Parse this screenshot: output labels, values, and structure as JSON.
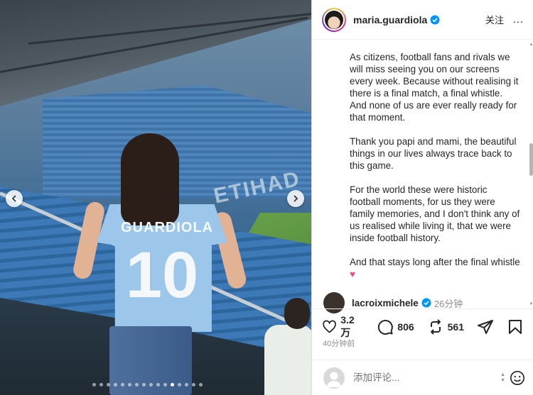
{
  "post": {
    "author": "maria.guardiola",
    "follow_label": "关注",
    "more_label": "…",
    "caption": [
      "As citizens, football fans and rivals we will miss seeing you on our screens every week. Because without realising it there is a final match, a final whistle. And none of us are ever really ready for that moment.",
      "Thank you papi and mami, the beautiful things in our lives always trace back to this game.",
      "For the world these were historic football moments, for us they were family memories, and I don't think any of us realised while living it, that we were inside football history.",
      "And that stays long after the final whistle"
    ],
    "caption_emoji": "♥",
    "photo": {
      "jersey_name": "GUARDIOLA",
      "jersey_number": "10",
      "stadium_text": "ETIHAD",
      "carousel_total": 16,
      "carousel_active": 11
    }
  },
  "comment": {
    "user": "lacroixmichele",
    "time": "26分钟"
  },
  "actions": {
    "likes": "3.2 万",
    "comments": "806",
    "shares": "561",
    "posted": "40分钟前"
  },
  "comment_bar": {
    "placeholder": "添加评论..."
  },
  "colors": {
    "verified": "#0095f6",
    "heart": "#ed4a8a"
  }
}
